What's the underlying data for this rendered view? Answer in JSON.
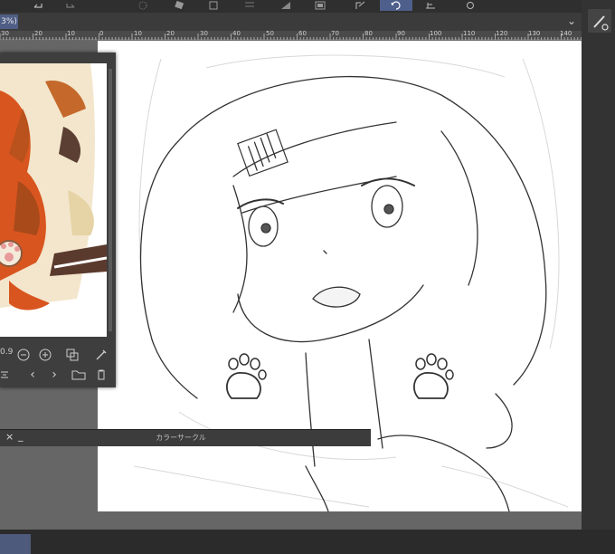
{
  "toolbar": {
    "buttons": [
      "undo-icon",
      "redo-icon",
      "fill-icon",
      "eraser-icon",
      "transform-icon",
      "snap-icon",
      "gradient-icon",
      "layer-icon",
      "export-icon",
      "rotate-icon",
      "ruler-icon",
      "settings-icon"
    ],
    "active_button": "rotate-icon"
  },
  "tab": {
    "zoom_label": "3%)"
  },
  "ruler": {
    "ticks": [
      "30",
      "20",
      "10",
      "0",
      "10",
      "20",
      "30",
      "40",
      "50",
      "60",
      "70",
      "80",
      "90",
      "100",
      "110",
      "120",
      "130",
      "140"
    ]
  },
  "navigator": {
    "zoom_value": "0.9",
    "controls": [
      "zoom-out",
      "zoom-in",
      "fit",
      "eyedropper",
      "flip",
      "prev",
      "next",
      "folder",
      "trash"
    ]
  },
  "color_circle": {
    "title": "カラーサークル",
    "close": "×",
    "minimize": "_"
  },
  "colors": {
    "accent": "#4d5f8a",
    "canvas": "#ffffff",
    "panel": "#3e3e3e"
  }
}
